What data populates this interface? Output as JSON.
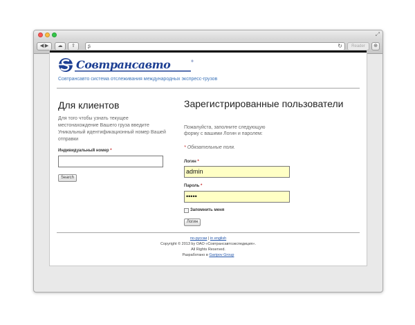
{
  "browser": {
    "reader_label": "Reader"
  },
  "header": {
    "tagline": "Совтрансавто система отслеживания международных экспресс-грузов"
  },
  "clients": {
    "title": "Для клиентов",
    "description": "Для того чтобы узнать текущее местонахождение Вашего груза введите Уникальный идентификационный номер Вашей отправки",
    "field_label": "Индивидуальный номер",
    "field_value": "",
    "search_label": "Search"
  },
  "login": {
    "title": "Зарегистрированные пользователи",
    "description": "Пожалуйста, заполните следующую форму с вашими Логин и паролем:",
    "required_note": "Обязательные поля.",
    "username_label": "Логин",
    "username_value": "admin",
    "password_label": "Пароль",
    "password_value": "•••••",
    "remember_label": "Запомнить меня",
    "submit_label": "Логин"
  },
  "footer": {
    "lang_ru": "по-русски",
    "lang_en": "in english",
    "copyright": "Copyright © 2013 by ОАО «Совтрансавтоэкспедиция».",
    "rights": "All Rights Reserved.",
    "developed_by": "Разработано в",
    "developer": "Garipov Group"
  },
  "colors": {
    "accent": "#3b73b9",
    "logo": "#1d3f93",
    "input_highlight": "#ffffc5",
    "required": "#c62828"
  },
  "icons": [
    "close-icon",
    "minimize-icon",
    "zoom-icon",
    "back-icon",
    "forward-icon",
    "cloud-icon",
    "share-icon",
    "reload-icon",
    "download-icon",
    "fullscreen-icon",
    "logo-emblem"
  ]
}
